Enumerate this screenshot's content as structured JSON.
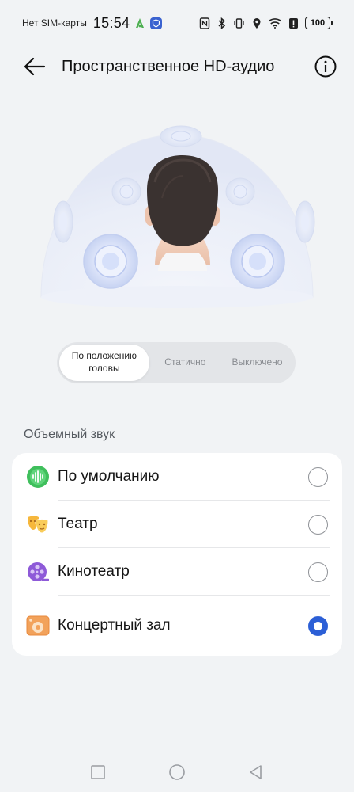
{
  "status_bar": {
    "carrier": "Нет SIM-карты",
    "time": "15:54",
    "battery": "100",
    "icons": [
      "nfc-icon",
      "bluetooth-icon",
      "vibrate-icon",
      "location-icon",
      "wifi-icon",
      "alert-icon",
      "battery-icon"
    ]
  },
  "header": {
    "title": "Пространственное HD-аудио",
    "back_icon": "back-arrow-icon",
    "info_icon": "info-icon"
  },
  "segmented_control": {
    "options": [
      "По положению головы",
      "Статично",
      "Выключено"
    ],
    "selected": "По положению головы"
  },
  "surround": {
    "section_label": "Объемный звук",
    "items": [
      {
        "label": "По умолчанию",
        "icon": "waveform-icon",
        "selected": false
      },
      {
        "label": "Театр",
        "icon": "theater-masks-icon",
        "selected": false
      },
      {
        "label": "Кинотеатр",
        "icon": "film-reel-icon",
        "selected": false
      },
      {
        "label": "Концертный зал",
        "icon": "concert-hall-icon",
        "selected": true
      }
    ]
  },
  "colors": {
    "accent": "#2c5fd6",
    "background": "#f1f3f5",
    "card": "#ffffff"
  },
  "nav_bar": {
    "buttons": [
      "recents-square-icon",
      "home-circle-icon",
      "back-triangle-icon"
    ]
  }
}
